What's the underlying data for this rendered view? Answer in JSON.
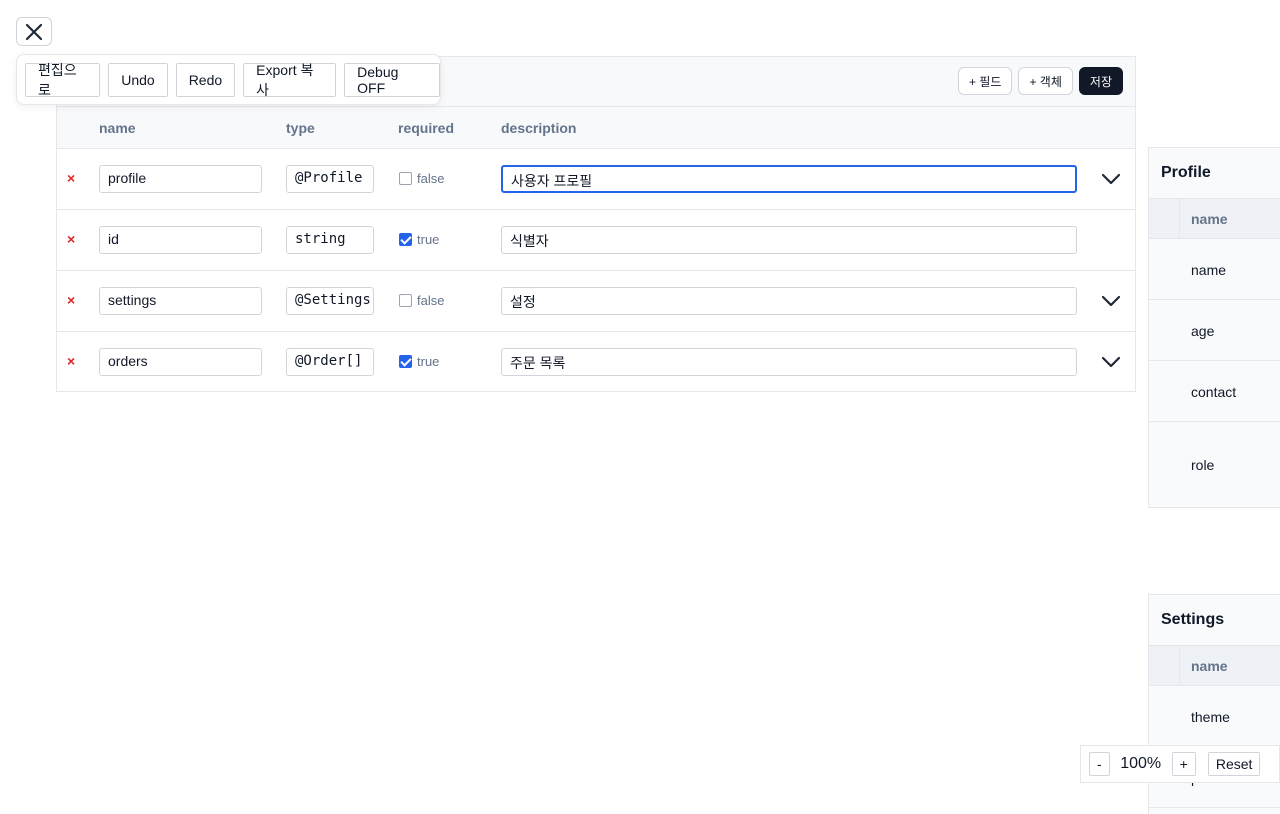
{
  "close_icon": "close-icon",
  "toolbar": {
    "edit_label": "편집으로",
    "undo_label": "Undo",
    "redo_label": "Redo",
    "export_label": "Export 복사",
    "debug_label": "Debug OFF"
  },
  "header": {
    "add_field_label": "+ 필드",
    "add_object_label": "+ 객체",
    "save_label": "저장"
  },
  "columns": {
    "name": "name",
    "type": "type",
    "required": "required",
    "description": "description"
  },
  "fields": [
    {
      "delete": "×",
      "name": "profile",
      "type": "@Profile",
      "required": false,
      "required_label": "false",
      "description": "사용자 프로필",
      "expandable": true,
      "focused": true
    },
    {
      "delete": "×",
      "name": "id",
      "type": "string",
      "required": true,
      "required_label": "true",
      "description": "식별자",
      "expandable": false,
      "focused": false
    },
    {
      "delete": "×",
      "name": "settings",
      "type": "@Settings",
      "required": false,
      "required_label": "false",
      "description": "설정",
      "expandable": true,
      "focused": false
    },
    {
      "delete": "×",
      "name": "orders",
      "type": "@Order[]",
      "required": true,
      "required_label": "true",
      "description": "주문 목록",
      "expandable": true,
      "focused": false
    }
  ],
  "side_panels": [
    {
      "title": "Profile",
      "column": "name",
      "rows": [
        "name",
        "age",
        "contact",
        "role"
      ]
    },
    {
      "title": "Settings",
      "column": "name",
      "rows": [
        "theme",
        "preferences"
      ]
    }
  ],
  "zoom": {
    "minus": "-",
    "value": "100%",
    "plus": "+",
    "reset": "Reset"
  },
  "colors": {
    "accent": "#2563eb",
    "delete": "#dc2626",
    "save_bg": "#111827"
  }
}
